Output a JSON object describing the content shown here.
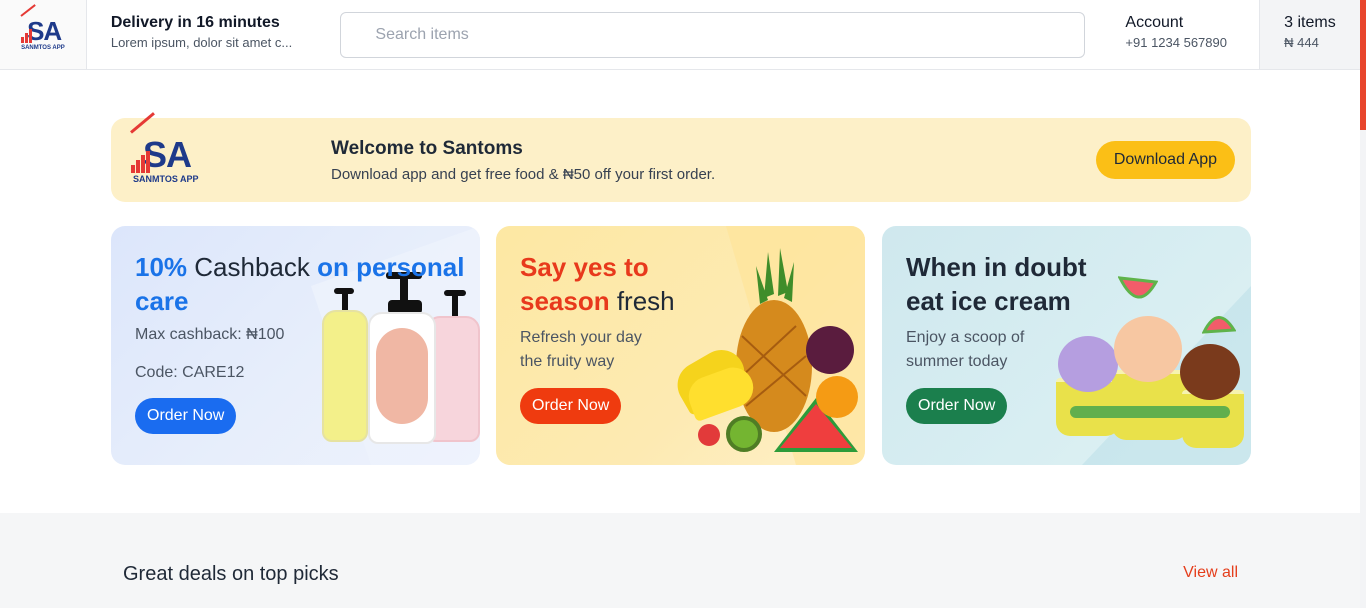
{
  "brand": {
    "logo_text": "SA",
    "logo_subtext": "SANMTOS APP"
  },
  "header": {
    "delivery_title": "Delivery in 16 minutes",
    "delivery_subtitle": "Lorem ipsum, dolor sit amet c...",
    "search_placeholder": "Search items",
    "account_title": "Account",
    "account_phone": "+91 1234 567890",
    "cart_items": "3 items",
    "cart_total": "₦ 444"
  },
  "banner": {
    "title": "Welcome to Santoms",
    "subtitle": "Download app and get free food & ₦50 off your first order.",
    "button_label": "Download App"
  },
  "cards": [
    {
      "headline_a": "10%",
      "headline_b": " Cashback ",
      "headline_c": "on personal care",
      "line1": "Max cashback: ₦100",
      "line2": "Code: CARE12",
      "button_label": "Order Now"
    },
    {
      "headline_a": "Say yes to season",
      "headline_b": " fresh",
      "line1": "Refresh your day",
      "line2": "the fruity way",
      "button_label": "Order Now"
    },
    {
      "headline_a": "When in doubt eat ice cream",
      "line1": "Enjoy a scoop of",
      "line2": "summer today",
      "button_label": "Order Now"
    }
  ],
  "deals": {
    "title": "Great deals on top picks",
    "view_all": "View all"
  },
  "colors": {
    "accent_blue": "#1a6cf0",
    "accent_red": "#ef3b0f",
    "accent_green": "#1b7f4d",
    "accent_yellow": "#fbbf16"
  }
}
